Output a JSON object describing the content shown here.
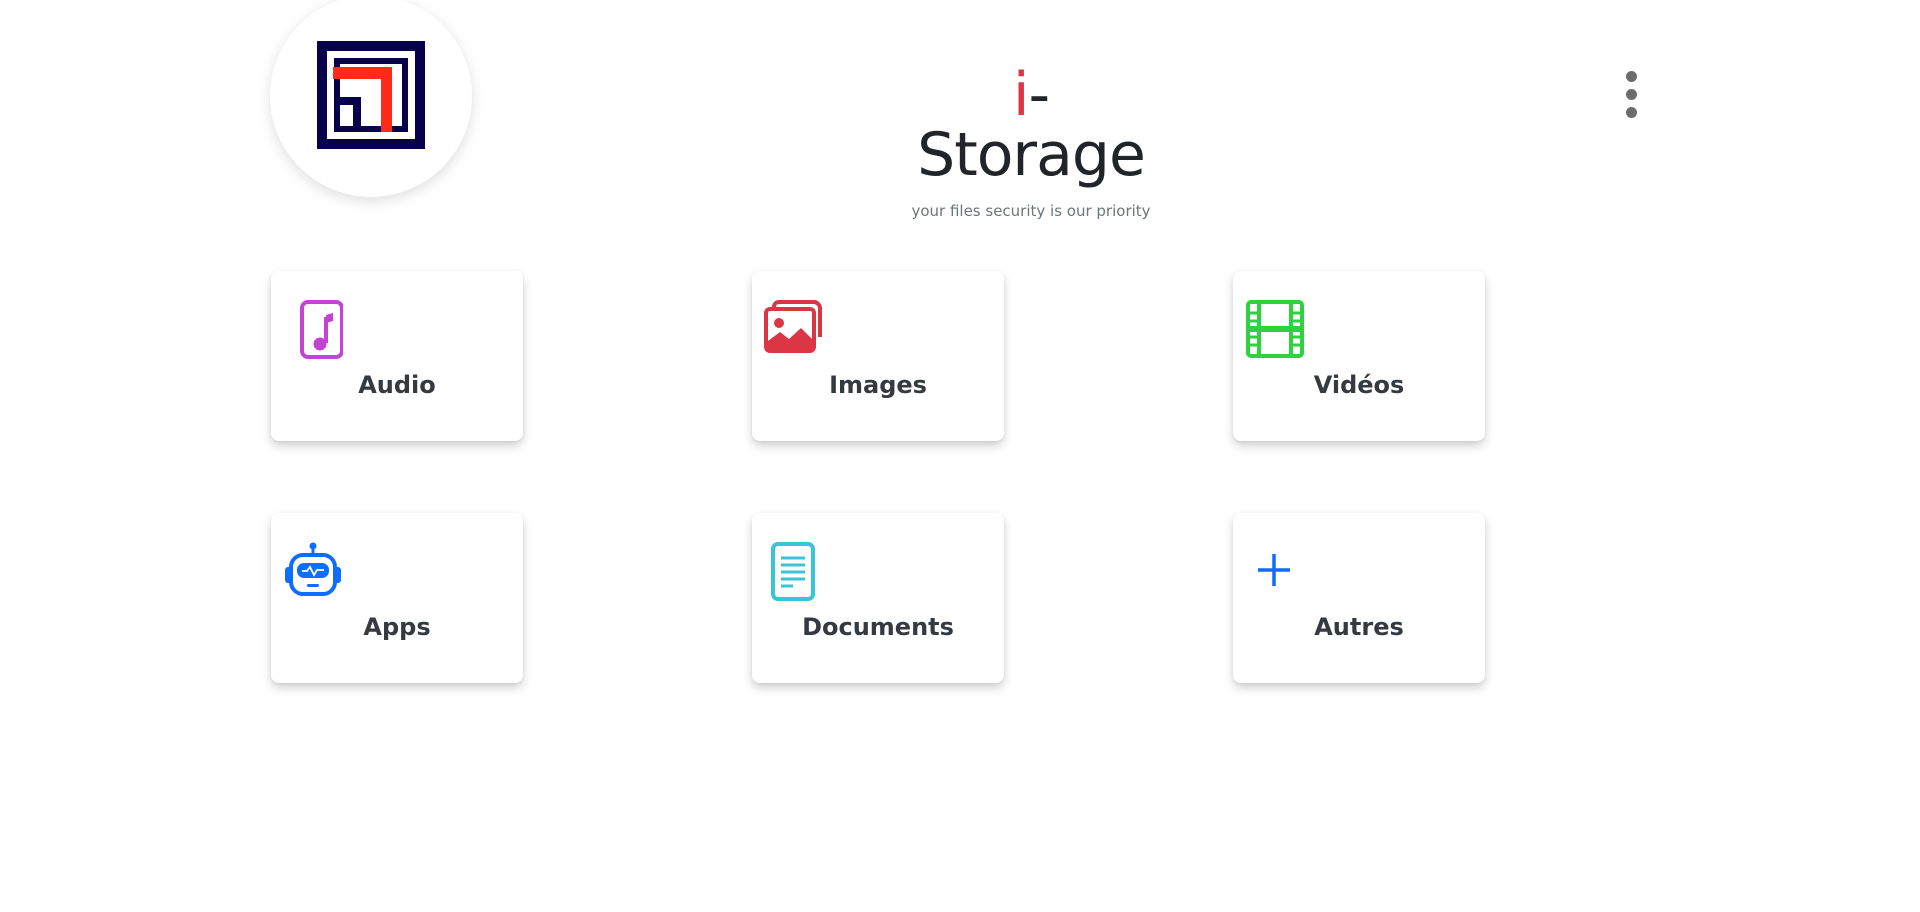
{
  "header": {
    "title_accent": "i",
    "title_rest": "-Storage",
    "subtitle": "your files security is our priority",
    "menu_icon": "more-vertical-icon",
    "logo_colors": {
      "frame": "#06004d",
      "accent": "#ff2a1a"
    }
  },
  "categories": [
    {
      "label": "Audio",
      "icon": "file-music-icon",
      "color": "#c243d4"
    },
    {
      "label": "Images",
      "icon": "images-icon",
      "color": "#dc3545"
    },
    {
      "label": "Vidéos",
      "icon": "film-icon",
      "color": "#30d13f"
    },
    {
      "label": "Apps",
      "icon": "robot-icon",
      "color": "#0d6efd"
    },
    {
      "label": "Documents",
      "icon": "file-text-icon",
      "color": "#3bc4d8"
    },
    {
      "label": "Autres",
      "icon": "plus-icon",
      "color": "#0d6efd"
    }
  ]
}
